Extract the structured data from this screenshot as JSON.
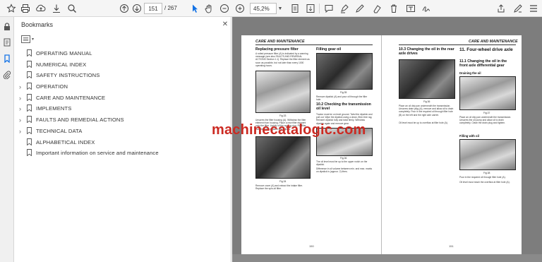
{
  "toolbar": {
    "current_page": "151",
    "total_pages": "/ 267",
    "zoom": "45,2%"
  },
  "panel": {
    "title": "Bookmarks",
    "items": [
      {
        "label": "OPERATING MANUAL",
        "expandable": false
      },
      {
        "label": "NUMERICAL INDEX",
        "expandable": false
      },
      {
        "label": "SAFETY INSTRUCTIONS",
        "expandable": false
      },
      {
        "label": "OPERATION",
        "expandable": true
      },
      {
        "label": "CARE AND MAINTENANCE",
        "expandable": true
      },
      {
        "label": "IMPLEMENTS",
        "expandable": true
      },
      {
        "label": "FAULTS AND REMEDIAL ACTIONS",
        "expandable": true
      },
      {
        "label": "TECHNICAL DATA",
        "expandable": true
      },
      {
        "label": "ALPHABETICAL INDEX",
        "expandable": false
      },
      {
        "label": "Important information on service and maintenance",
        "expandable": false
      }
    ]
  },
  "document": {
    "left_page": {
      "header": "CARE AND MAINTENANCE",
      "col1_heading": "Replacing pressure filter",
      "col1_body": "A rotted pressure filter (A) is indicated by a warning message (see also FAULTS AND REMEDIAL ACTIONS Section 1.1). Replace the filter element as soon as possible, but not later than every 1000 operating hours.",
      "fig_a": "Fig.33",
      "steps_a": "Unscrew the filter housing (A). Withdraw the filter element from housing. Place a new filter element onto the filter. Lightly oil the sealing ring. Put filter housing back in place and tighten.",
      "fig_b": "Fig.34",
      "steps_b": "Remove cover (A) and extract the intake filter. Replace the spin-oil filter.",
      "col2_heading": "Filling gear oil",
      "fig_c": "Fig.35",
      "steps_c": "Remove dipstick (A) and pour oil through the filler hole.",
      "section_102": "10.2  Checking the transmission oil level",
      "steps_d": "Tractor must be on level ground. Twist the dipstick and pull out. Wipe the dipstick using a clean, fibre-free rag. Reinsert dipstick fully and twist firmly. Withdraw dipstick again and remove gear.",
      "fig_d": "Fig.36",
      "steps_e": "The oil level must be up to the upper notch on the dipstick.",
      "note": "Difference in oil volume between min. and max. marks on dipstick is (approx. 2) litres.",
      "page_number": "150"
    },
    "right_page": {
      "header": "CARE AND MAINTENANCE",
      "section_103": "10.3  Changing the oil in the rear axle drives",
      "fig_e": "Fig.36",
      "steps_f": "Place an oil drip pan underneath the transmission. Unscrew drain plug (A), remove and allow oil to drain completely. Pour in the required oil through filler hole (B) on the left and the right axle carrier.",
      "oil_note": "Oil level must be up to overflow at filler hole (A).",
      "section_11": "11.  Four-wheel drive axle",
      "section_111": "11.1  Changing the oil in the front axle differential gear",
      "draining": "Draining the oil",
      "fig_f": "Fig.37",
      "steps_g": "Place an oil drip pan underneath the transmission. Unscrew the oil pump and allow oil to drain completely. Clean the drain plug and tighten.",
      "filling": "Filling with oil",
      "fig_g": "Fig.38",
      "steps_h": "Pour in the required oil through filler hole (A).",
      "level_note": "Oil level must reach the overflow at filler hole (A).",
      "page_number": "151"
    },
    "watermark": "machinecatalogic.com"
  },
  "colors": {
    "toolbar_bg": "#f5f5f5",
    "doc_bg": "#7d7d7d",
    "watermark": "#cc2a22",
    "accent_blue": "#1473e6"
  },
  "icons": [
    "star-icon",
    "print-icon",
    "upload-icon",
    "download-icon",
    "search-icon",
    "page-up-icon",
    "page-down-icon",
    "select-cursor-icon",
    "hand-icon",
    "zoom-out-icon",
    "zoom-in-icon",
    "fit-page-icon",
    "scroll-mode-icon",
    "comment-icon",
    "highlight-icon",
    "draw-icon",
    "erase-icon",
    "text-icon",
    "sign-icon",
    "share-icon",
    "menu-icon",
    "lock-icon",
    "bookmark-icon",
    "attachment-icon",
    "close-icon",
    "options-icon"
  ]
}
